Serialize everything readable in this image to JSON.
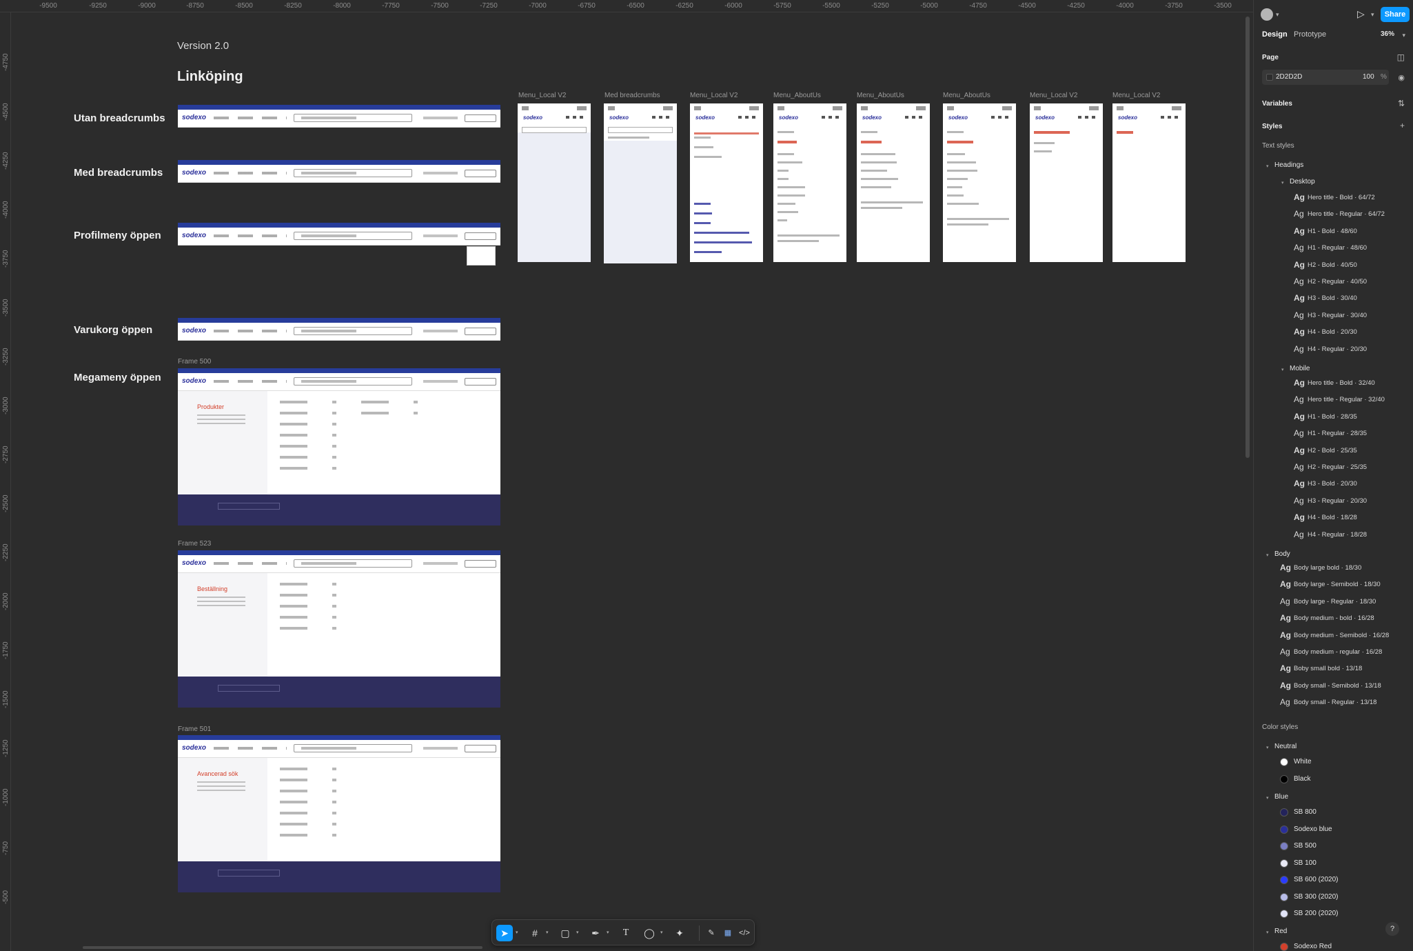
{
  "ruler": {
    "top": [
      "-9500",
      "-9250",
      "-9000",
      "-8750",
      "-8500",
      "-8250",
      "-8000",
      "-7750",
      "-7500",
      "-7250",
      "-7000",
      "-6750",
      "-6500",
      "-6250",
      "-6000",
      "-5750",
      "-5500",
      "-5250",
      "-5000",
      "-4750",
      "-4500",
      "-4250",
      "-4000",
      "-3750",
      "-3500"
    ],
    "left": [
      "-4750",
      "-4500",
      "-4250",
      "-4000",
      "-3750",
      "-3500",
      "-3250",
      "-3000",
      "-2750",
      "-2500",
      "-2250",
      "-2000",
      "-1750",
      "-1500",
      "-1250",
      "-1000",
      "-750",
      "-500"
    ]
  },
  "canvas": {
    "version": "Version 2.0",
    "city": "Linköping",
    "rows": [
      "Utan breadcrumbs",
      "Med breadcrumbs",
      "Profilmeny öppen",
      "Varukorg öppen",
      "Megameny öppen"
    ],
    "frame_labels": [
      "Frame 500",
      "Frame 523",
      "Frame 501"
    ],
    "logo": "sodexo",
    "mega_titles": [
      "Produkter",
      "Beställning",
      "Avancerad sök"
    ],
    "mobile_labels": [
      "Menu_Local V2",
      "Med breadcrumbs",
      "Menu_Local V2",
      "Menu_AboutUs",
      "Menu_AboutUs",
      "Menu_AboutUs",
      "Menu_Local V2",
      "Menu_Local V2"
    ]
  },
  "header": {
    "share": "Share",
    "tab_design": "Design",
    "tab_prototype": "Prototype",
    "zoom": "36%"
  },
  "panel": {
    "page_title": "Page",
    "page_color": "2D2D2D",
    "page_opacity": "100",
    "page_pct": "%",
    "variables": "Variables",
    "styles": "Styles",
    "text_styles": "Text styles",
    "headings": "Headings",
    "desktop": "Desktop",
    "mobile": "Mobile",
    "body": "Body",
    "desktop_styles": [
      {
        "name": "Hero title - Bold · 64/72",
        "bold": true
      },
      {
        "name": "Hero title - Regular · 64/72",
        "bold": false
      },
      {
        "name": "H1 - Bold · 48/60",
        "bold": true
      },
      {
        "name": "H1 - Regular · 48/60",
        "bold": false
      },
      {
        "name": "H2 - Bold · 40/50",
        "bold": true
      },
      {
        "name": "H2 - Regular · 40/50",
        "bold": false
      },
      {
        "name": "H3 - Bold · 30/40",
        "bold": true
      },
      {
        "name": "H3 - Regular · 30/40",
        "bold": false
      },
      {
        "name": "H4 - Bold · 20/30",
        "bold": true
      },
      {
        "name": "H4 - Regular · 20/30",
        "bold": false
      }
    ],
    "mobile_styles": [
      {
        "name": "Hero title - Bold · 32/40",
        "bold": true
      },
      {
        "name": "Hero title - Regular · 32/40",
        "bold": false
      },
      {
        "name": "H1 - Bold · 28/35",
        "bold": true
      },
      {
        "name": "H1 - Regular · 28/35",
        "bold": false
      },
      {
        "name": "H2 - Bold · 25/35",
        "bold": true
      },
      {
        "name": "H2 - Regular · 25/35",
        "bold": false
      },
      {
        "name": "H3 - Bold · 20/30",
        "bold": true
      },
      {
        "name": "H3 - Regular · 20/30",
        "bold": false
      },
      {
        "name": "H4 - Bold · 18/28",
        "bold": true
      },
      {
        "name": "H4 - Regular · 18/28",
        "bold": false
      }
    ],
    "body_styles": [
      {
        "name": "Body large bold · 18/30",
        "bold": true
      },
      {
        "name": "Body large - Semibold · 18/30",
        "bold": true
      },
      {
        "name": "Body large - Regular · 18/30",
        "bold": false
      },
      {
        "name": "Body medium - bold · 16/28",
        "bold": true
      },
      {
        "name": "Body medium - Semibold · 16/28",
        "bold": true
      },
      {
        "name": "Body medium - regular · 16/28",
        "bold": false
      },
      {
        "name": "Boby small bold · 13/18",
        "bold": true
      },
      {
        "name": "Body small - Semibold · 13/18",
        "bold": true
      },
      {
        "name": "Body small - Regular · 13/18",
        "bold": false
      }
    ],
    "color_styles": "Color styles",
    "neutral": "Neutral",
    "blue": "Blue",
    "red": "Red",
    "neutral_colors": [
      {
        "name": "White",
        "hex": "#ffffff"
      },
      {
        "name": "Black",
        "hex": "#000000"
      }
    ],
    "blue_colors": [
      {
        "name": "SB 800",
        "hex": "#23235b"
      },
      {
        "name": "Sodexo blue",
        "hex": "#2a2f9a"
      },
      {
        "name": "SB 500",
        "hex": "#7b7fc4"
      },
      {
        "name": "SB 100",
        "hex": "#e8e9f5"
      },
      {
        "name": "SB 600 (2020)",
        "hex": "#2b3cff"
      },
      {
        "name": "SB 300 (2020)",
        "hex": "#b8bce8"
      },
      {
        "name": "SB 200 (2020)",
        "hex": "#e1e3f6"
      }
    ],
    "red_colors": [
      {
        "name": "Sodexo Red",
        "hex": "#d3402b"
      }
    ]
  },
  "help": "?"
}
